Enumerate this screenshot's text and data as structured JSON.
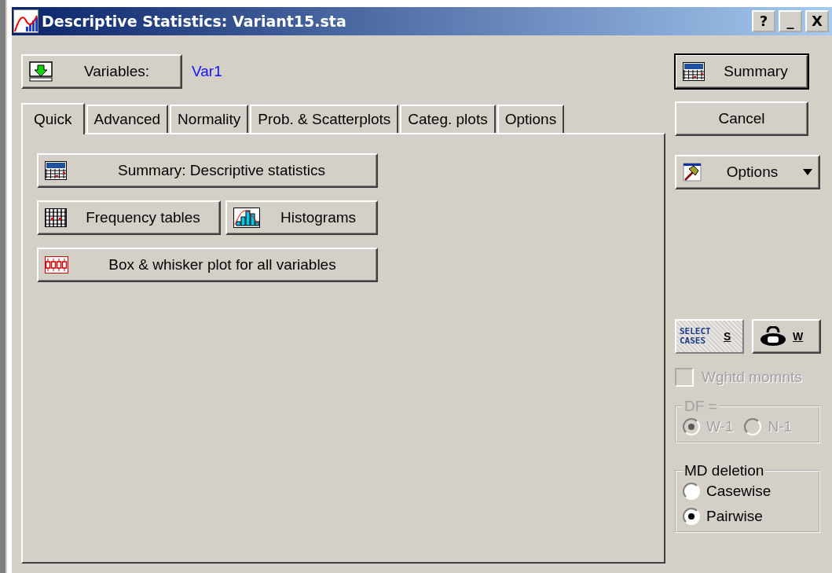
{
  "window": {
    "title": "Descriptive Statistics: Variant15.sta",
    "controls": [
      "?",
      "_",
      "X"
    ]
  },
  "variables": {
    "button": "Variables:",
    "value": "Var1"
  },
  "tabs": [
    {
      "label": "Quick",
      "selected": true
    },
    {
      "label": "Advanced",
      "selected": false
    },
    {
      "label": "Normality",
      "selected": false
    },
    {
      "label": "Prob. & Scatterplots",
      "selected": false
    },
    {
      "label": "Categ. plots",
      "selected": false
    },
    {
      "label": "Options",
      "selected": false
    }
  ],
  "quick_buttons": [
    {
      "kind": "summary",
      "label": "Summary: Descriptive statistics"
    },
    {
      "kind": "frequency",
      "label": "Frequency tables"
    },
    {
      "kind": "histogram",
      "label": "Histograms"
    },
    {
      "kind": "boxplot",
      "label": "Box & whisker plot for all variables"
    }
  ],
  "side": {
    "summary": "Summary",
    "cancel": "Cancel",
    "options": "Options",
    "select_cases": "SELECT CASES",
    "select_key": "S",
    "weight_key": "W"
  },
  "weighted": {
    "label": "Wghtd momnts",
    "checked": false,
    "disabled": true
  },
  "df_group": {
    "title": "DF =",
    "disabled": true,
    "options": [
      {
        "label": "W-1",
        "selected": true
      },
      {
        "label": "N-1",
        "selected": false
      }
    ]
  },
  "md_group": {
    "title": "MD deletion",
    "options": [
      {
        "label": "Casewise",
        "selected": false
      },
      {
        "label": "Pairwise",
        "selected": true
      }
    ]
  }
}
